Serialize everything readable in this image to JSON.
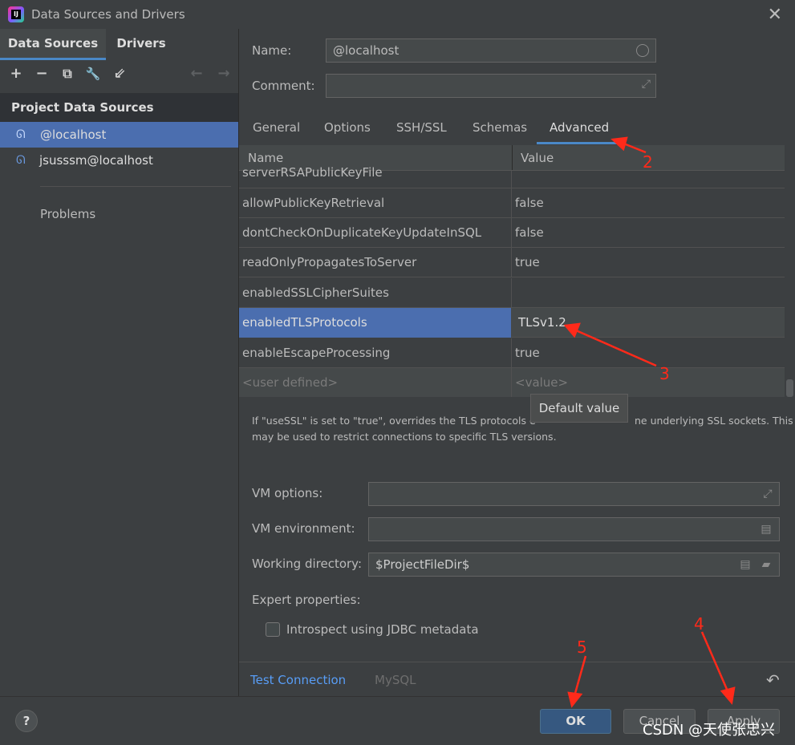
{
  "window": {
    "title": "Data Sources and Drivers",
    "app_icon_text": "IJ",
    "close_glyph": "✕"
  },
  "left": {
    "tabs": [
      {
        "label": "Data Sources"
      },
      {
        "label": "Drivers"
      }
    ],
    "toolbar": {
      "add": "+",
      "remove": "−",
      "duplicate": "⧉",
      "settings": "🔧",
      "import": "⇙",
      "back": "←",
      "forward": "→"
    },
    "group_header": "Project Data Sources",
    "items": [
      {
        "label": "@localhost"
      },
      {
        "label": "jsusssm@localhost"
      }
    ],
    "problems_label": "Problems"
  },
  "form": {
    "name_label": "Name:",
    "name_value": "@localhost",
    "comment_label": "Comment:",
    "comment_value": ""
  },
  "tabs": [
    {
      "label": "General"
    },
    {
      "label": "Options"
    },
    {
      "label": "SSH/SSL"
    },
    {
      "label": "Schemas"
    },
    {
      "label": "Advanced"
    }
  ],
  "table": {
    "headers": {
      "name": "Name",
      "value": "Value"
    },
    "rows": [
      {
        "key": "serverRSAPublicKeyFile",
        "value": ""
      },
      {
        "key": "allowPublicKeyRetrieval",
        "value": "false"
      },
      {
        "key": "dontCheckOnDuplicateKeyUpdateInSQL",
        "value": "false"
      },
      {
        "key": "readOnlyPropagatesToServer",
        "value": "true"
      },
      {
        "key": "enabledSSLCipherSuites",
        "value": ""
      },
      {
        "key": "enabledTLSProtocols",
        "value": "TLSv1.2"
      },
      {
        "key": "enableEscapeProcessing",
        "value": "true"
      },
      {
        "key": "<user defined>",
        "value": "<value>"
      }
    ]
  },
  "tooltip": "Default value",
  "description": {
    "line1_left": "If \"useSSL\" is set to \"true\", overrides the TLS protocols e",
    "line1_right": "ne underlying SSL sockets. This",
    "line2": "may be used to restrict connections to specific TLS versions."
  },
  "vm": {
    "options_label": "VM options:",
    "options_value": "",
    "environment_label": "VM environment:",
    "environment_value": "",
    "workdir_label": "Working directory:",
    "workdir_value": "$ProjectFileDir$",
    "expert_label": "Expert properties:",
    "introspect_label": "Introspect using JDBC metadata",
    "introspect_checked": false
  },
  "bottom": {
    "test_connection": "Test Connection",
    "driver": "MySQL",
    "undo_glyph": "↶"
  },
  "footer": {
    "help": "?",
    "ok": "OK",
    "cancel": "Cancel",
    "apply": "Apply"
  },
  "annotations": {
    "n2": "2",
    "n3": "3",
    "n4": "4",
    "n5": "5",
    "watermark": "CSDN @天使张忠兴",
    "color": "#ff2a1a"
  },
  "colors": {
    "accent": "#4a88c7",
    "selection": "#4b6eaf",
    "link": "#589df6",
    "background": "#3c3f41"
  }
}
